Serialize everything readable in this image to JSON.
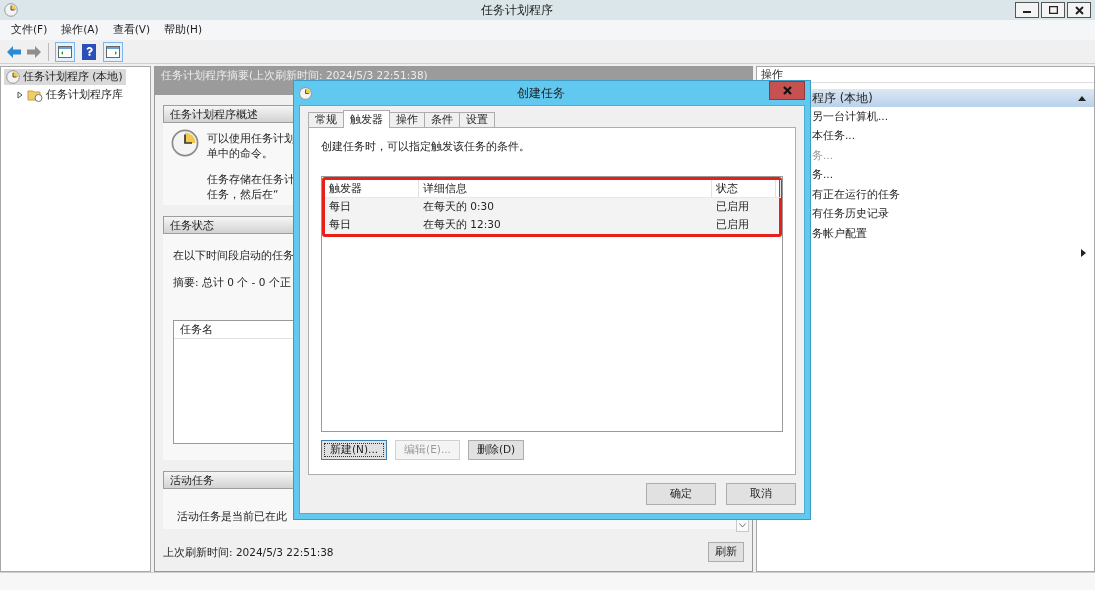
{
  "window": {
    "title": "任务计划程序"
  },
  "menu": [
    "文件(F)",
    "操作(A)",
    "查看(V)",
    "帮助(H)"
  ],
  "navigation": {
    "back": {
      "disabled": false
    },
    "forward": {
      "disabled": true
    }
  },
  "tree": [
    {
      "label": "任务计划程序 (本地)",
      "selected": true,
      "children": [
        {
          "label": "任务计划程序库",
          "selected": false,
          "expanded": false
        }
      ]
    }
  ],
  "summary": {
    "header": "任务计划程序摘要(上次刷新时间: 2024/5/3 22:51:38)",
    "overview": {
      "title": "任务计划程序概述",
      "paragraphs": [
        [
          "可以使用任务计划",
          "单中的命令。"
        ],
        [
          "任务存储在任务计",
          "任务，然后在“"
        ]
      ]
    },
    "status": {
      "title": "任务状态",
      "intro": "在以下时间段启动的任务",
      "summary": "摘要: 总计 0 个 - 0 个正",
      "columns": [
        "任务名"
      ]
    },
    "active": {
      "title": "活动任务",
      "text": "活动任务是当前已在此"
    },
    "last_refresh": "上次刷新时间: 2024/5/3 22:51:38",
    "refresh_button": "刷新"
  },
  "actions_panel": {
    "title": "操作",
    "group": "程序 (本地)",
    "items": [
      {
        "kind": "action",
        "label": "另一台计算机...",
        "disabled": false
      },
      {
        "kind": "action",
        "label": "本任务...",
        "disabled": false
      },
      {
        "kind": "action",
        "label": "务...",
        "disabled": true
      },
      {
        "kind": "action",
        "label": "务...",
        "disabled": false
      },
      {
        "kind": "action",
        "label": "有正在运行的任务",
        "disabled": false
      },
      {
        "kind": "action",
        "label": "有任务历史记录",
        "disabled": false
      },
      {
        "kind": "action",
        "label": "务帐户配置",
        "disabled": false
      },
      {
        "kind": "submenu",
        "disabled": false
      }
    ]
  },
  "dialog": {
    "title": "创建任务",
    "tabs": [
      {
        "label": "常规",
        "selected": false
      },
      {
        "label": "触发器",
        "selected": true
      },
      {
        "label": "操作",
        "selected": false
      },
      {
        "label": "条件",
        "selected": false
      },
      {
        "label": "设置",
        "selected": false
      }
    ],
    "description": "创建任务时，可以指定触发该任务的条件。",
    "columns": [
      "触发器",
      "详细信息",
      "状态"
    ],
    "rows": [
      [
        "每日",
        "在每天的 0:30",
        "已启用"
      ],
      [
        "每日",
        "在每天的 12:30",
        "已启用"
      ]
    ],
    "buttons": [
      {
        "label": "新建(N)...",
        "disabled": false,
        "focused": true
      },
      {
        "label": "编辑(E)...",
        "disabled": true,
        "focused": false
      },
      {
        "label": "删除(D)",
        "disabled": false,
        "focused": false
      }
    ],
    "footer_buttons": [
      "确定",
      "取消"
    ]
  }
}
